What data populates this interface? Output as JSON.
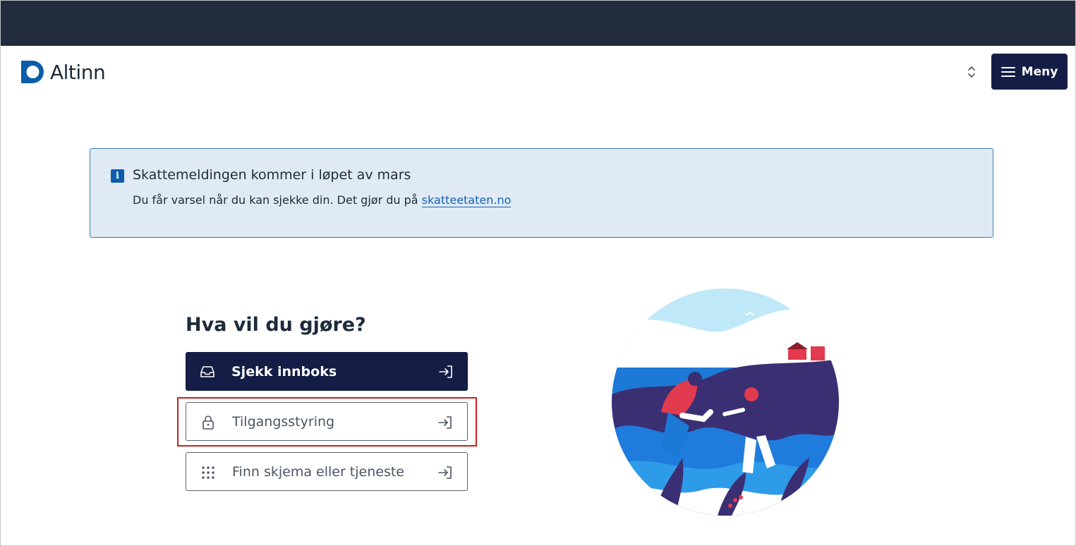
{
  "header": {
    "logo_text": "Altinn",
    "menu_label": "Meny"
  },
  "alert": {
    "title": "Skattemeldingen kommer i løpet av mars",
    "text": "Du får varsel når du kan sjekke din. Det gjør du på",
    "link_text": "skatteetaten.no",
    "icon": "info-icon"
  },
  "main": {
    "heading": "Hva vil du gjøre?",
    "actions": [
      {
        "label": "Sjekk innboks",
        "icon": "inbox-icon",
        "variant": "primary"
      },
      {
        "label": "Tilgangsstyring",
        "icon": "lock-icon",
        "variant": "secondary"
      },
      {
        "label": "Finn skjema eller tjeneste",
        "icon": "grid-dots-icon",
        "variant": "secondary"
      }
    ]
  },
  "colors": {
    "top_bar": "#232c3d",
    "brand_navy": "#131d45",
    "alert_bg": "#dfeaf5",
    "alert_border": "#3c7cb3",
    "link": "#1763b1",
    "highlight": "#cc1f1f"
  }
}
